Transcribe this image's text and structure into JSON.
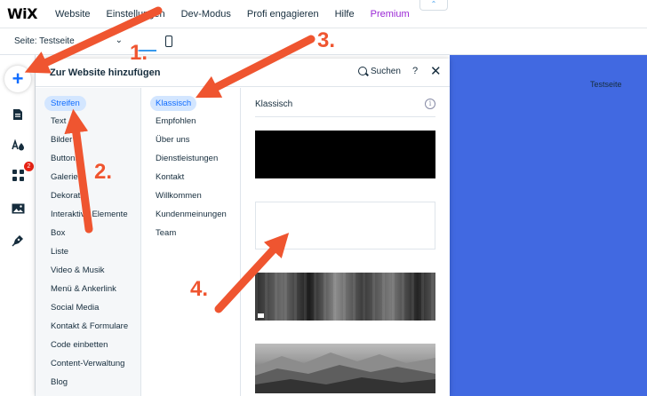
{
  "topbar": {
    "logo": "WiX",
    "nav": [
      "Website",
      "Einstellungen",
      "Dev-Modus",
      "Profi engagieren",
      "Hilfe"
    ],
    "premium": "Premium",
    "collapse_glyph": "⌃"
  },
  "secondbar": {
    "page_select": "Seite: Testseite",
    "chevron": "⌄"
  },
  "rail": {
    "add_glyph": "+",
    "apps_badge": "2"
  },
  "canvas": {
    "page_name": "Testseite",
    "color": "#4169e1"
  },
  "panel": {
    "title": "Zur Website hinzufügen",
    "search_label": "Suchen",
    "help_glyph": "?",
    "close_glyph": "✕",
    "categories": [
      "Streifen",
      "Text",
      "Bilder",
      "Buttons",
      "Galerien",
      "Dekorativ",
      "Interaktive Elemente",
      "Box",
      "Liste",
      "Video & Musik",
      "Menü & Ankerlink",
      "Social Media",
      "Kontakt & Formulare",
      "Code einbetten",
      "Content-Verwaltung",
      "Blog"
    ],
    "active_category": "Streifen",
    "subcategories": [
      "Klassisch",
      "Empfohlen",
      "Über uns",
      "Dienstleistungen",
      "Kontakt",
      "Willkommen",
      "Kundenmeinungen",
      "Team"
    ],
    "active_subcategory": "Klassisch",
    "section_title": "Klassisch",
    "info_glyph": "i"
  },
  "annotations": {
    "labels": [
      "1.",
      "2.",
      "3.",
      "4."
    ],
    "color": "#ef5530"
  }
}
